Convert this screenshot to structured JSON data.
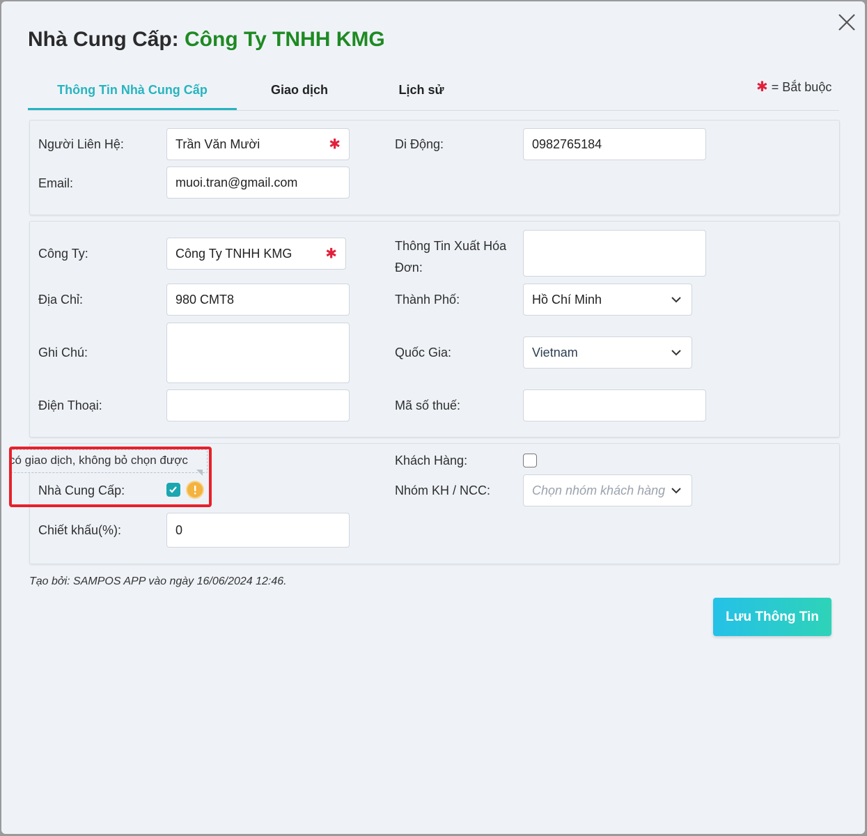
{
  "header": {
    "title_prefix": "Nhà Cung Cấp: ",
    "title_name": "Công Ty TNHH KMG",
    "close_icon": "close-icon"
  },
  "tabs": [
    {
      "label": "Thông Tin Nhà Cung Cấp",
      "active": true
    },
    {
      "label": "Giao dịch",
      "active": false
    },
    {
      "label": "Lịch sử",
      "active": false
    }
  ],
  "required_note": {
    "star": "✱",
    "text": " = Bắt buộc"
  },
  "contact": {
    "contact_person_label": "Người Liên Hệ:",
    "contact_person_value": "Trần Văn Mười",
    "mobile_label": "Di Động:",
    "mobile_value": "0982765184",
    "email_label": "Email:",
    "email_value": "muoi.tran@gmail.com"
  },
  "company": {
    "company_label": "Công Ty:",
    "company_value": "Công Ty TNHH KMG",
    "invoice_label": "Thông Tin Xuất Hóa Đơn:",
    "invoice_value": "",
    "address_label": "Địa Chỉ:",
    "address_value": "980 CMT8",
    "city_label": "Thành Phố:",
    "city_value": "Hồ Chí Minh",
    "note_label": "Ghi Chú:",
    "note_value": "",
    "country_label": "Quốc Gia:",
    "country_value": "Vietnam",
    "phone_label": "Điện Thoại:",
    "phone_value": "",
    "tax_label": "Mã số thuế:",
    "tax_value": ""
  },
  "flags": {
    "tooltip_text": "có giao dịch, không bỏ chọn được",
    "supplier_label": "Nhà Cung Cấp:",
    "supplier_checked": true,
    "customer_label": "Khách Hàng:",
    "customer_checked": false,
    "group_label": "Nhóm KH / NCC:",
    "group_placeholder": "Chọn nhóm khách hàng",
    "discount_label": "Chiết khấu(%):",
    "discount_value": "0"
  },
  "footer": {
    "created_note": "Tạo bởi: SAMPOS APP vào ngày 16/06/2024 12:46.",
    "save_label": "Lưu Thông Tin"
  },
  "colors": {
    "accent": "#27b4bf",
    "title_name": "#1e8a22",
    "required": "#e2203b",
    "highlight": "#e8202a",
    "button_gradient_start": "#25c1e8",
    "button_gradient_end": "#2ed3b7"
  }
}
